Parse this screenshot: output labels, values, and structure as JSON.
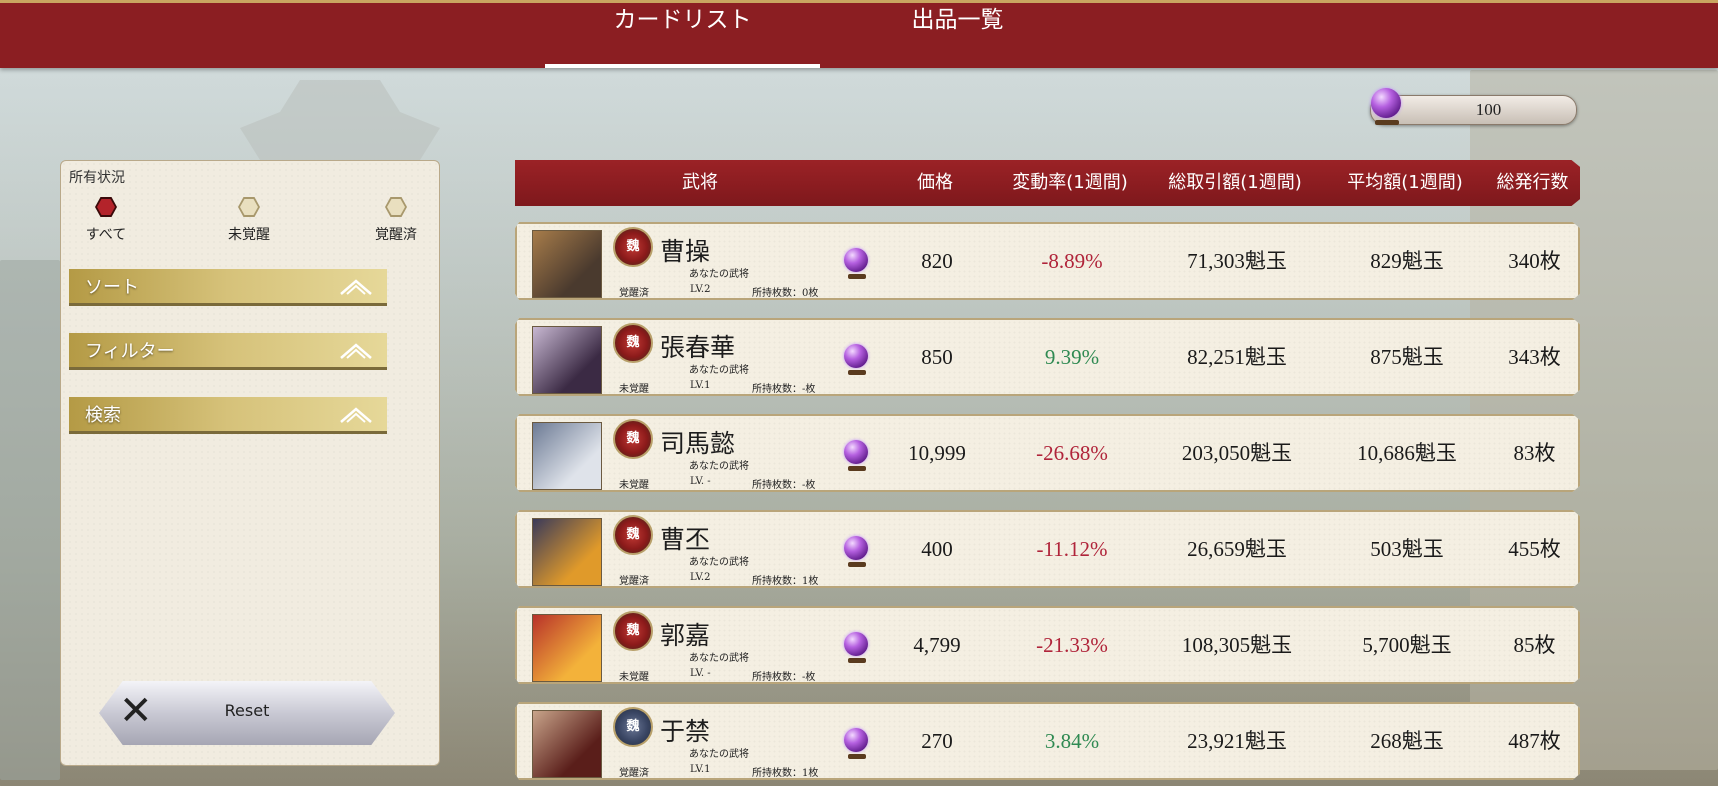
{
  "tabs": [
    {
      "label": "カードリスト",
      "active": true
    },
    {
      "label": "出品一覧",
      "active": false
    }
  ],
  "currency": {
    "amount": "100",
    "icon": "purple-gem-icon"
  },
  "filter_panel": {
    "title": "所有状況",
    "options": [
      {
        "label": "すべて",
        "selected": true
      },
      {
        "label": "未覚醒",
        "selected": false
      },
      {
        "label": "覚醒済",
        "selected": false
      }
    ],
    "sections": [
      {
        "label": "ソート"
      },
      {
        "label": "フィルター"
      },
      {
        "label": "検索"
      }
    ],
    "reset_label": "Reset"
  },
  "table": {
    "headers": [
      "武将",
      "価格",
      "変動率(1週間)",
      "総取引額(1週間)",
      "平均額(1週間)",
      "総発行数"
    ],
    "rows": [
      {
        "name": "曹操",
        "badge": "魏",
        "badge_color": "red",
        "subtitle": "あなたの武将",
        "status": "覚醒済",
        "level": "LV.2",
        "owned": "所持枚数：0枚",
        "price": "820",
        "change": "-8.89%",
        "trend": "neg",
        "total": "71,303魁玉",
        "avg": "829魁玉",
        "issued": "340枚",
        "portrait_colors": [
          "#4a3a2e",
          "#a77c4a"
        ]
      },
      {
        "name": "張春華",
        "badge": "魏",
        "badge_color": "red",
        "subtitle": "あなたの武将",
        "status": "未覚醒",
        "level": "LV.1",
        "owned": "所持枚数：-枚",
        "price": "850",
        "change": "9.39%",
        "trend": "pos",
        "total": "82,251魁玉",
        "avg": "875魁玉",
        "issued": "343枚",
        "portrait_colors": [
          "#3b2a44",
          "#c8b8d2"
        ]
      },
      {
        "name": "司馬懿",
        "badge": "魏",
        "badge_color": "red",
        "subtitle": "あなたの武将",
        "status": "未覚醒",
        "level": "LV. -",
        "owned": "所持枚数：-枚",
        "price": "10,999",
        "change": "-26.68%",
        "trend": "neg",
        "total": "203,050魁玉",
        "avg": "10,686魁玉",
        "issued": "83枚",
        "portrait_colors": [
          "#dfe3ea",
          "#6d7b95"
        ]
      },
      {
        "name": "曹丕",
        "badge": "魏",
        "badge_color": "red",
        "subtitle": "あなたの武将",
        "status": "覚醒済",
        "level": "LV.2",
        "owned": "所持枚数：1枚",
        "price": "400",
        "change": "-11.12%",
        "trend": "neg",
        "total": "26,659魁玉",
        "avg": "503魁玉",
        "issued": "455枚",
        "portrait_colors": [
          "#e09a2a",
          "#3a3a5a"
        ]
      },
      {
        "name": "郭嘉",
        "badge": "魏",
        "badge_color": "red",
        "subtitle": "あなたの武将",
        "status": "未覚醒",
        "level": "LV. -",
        "owned": "所持枚数：-枚",
        "price": "4,799",
        "change": "-21.33%",
        "trend": "neg",
        "total": "108,305魁玉",
        "avg": "5,700魁玉",
        "issued": "85枚",
        "portrait_colors": [
          "#f3b23a",
          "#b8322a"
        ]
      },
      {
        "name": "于禁",
        "badge": "魏",
        "badge_color": "blue",
        "subtitle": "あなたの武将",
        "status": "覚醒済",
        "level": "LV.1",
        "owned": "所持枚数：1枚",
        "price": "270",
        "change": "3.84%",
        "trend": "pos",
        "total": "23,921魁玉",
        "avg": "268魁玉",
        "issued": "487枚",
        "portrait_colors": [
          "#5a1e1a",
          "#c8a48a"
        ]
      }
    ]
  }
}
